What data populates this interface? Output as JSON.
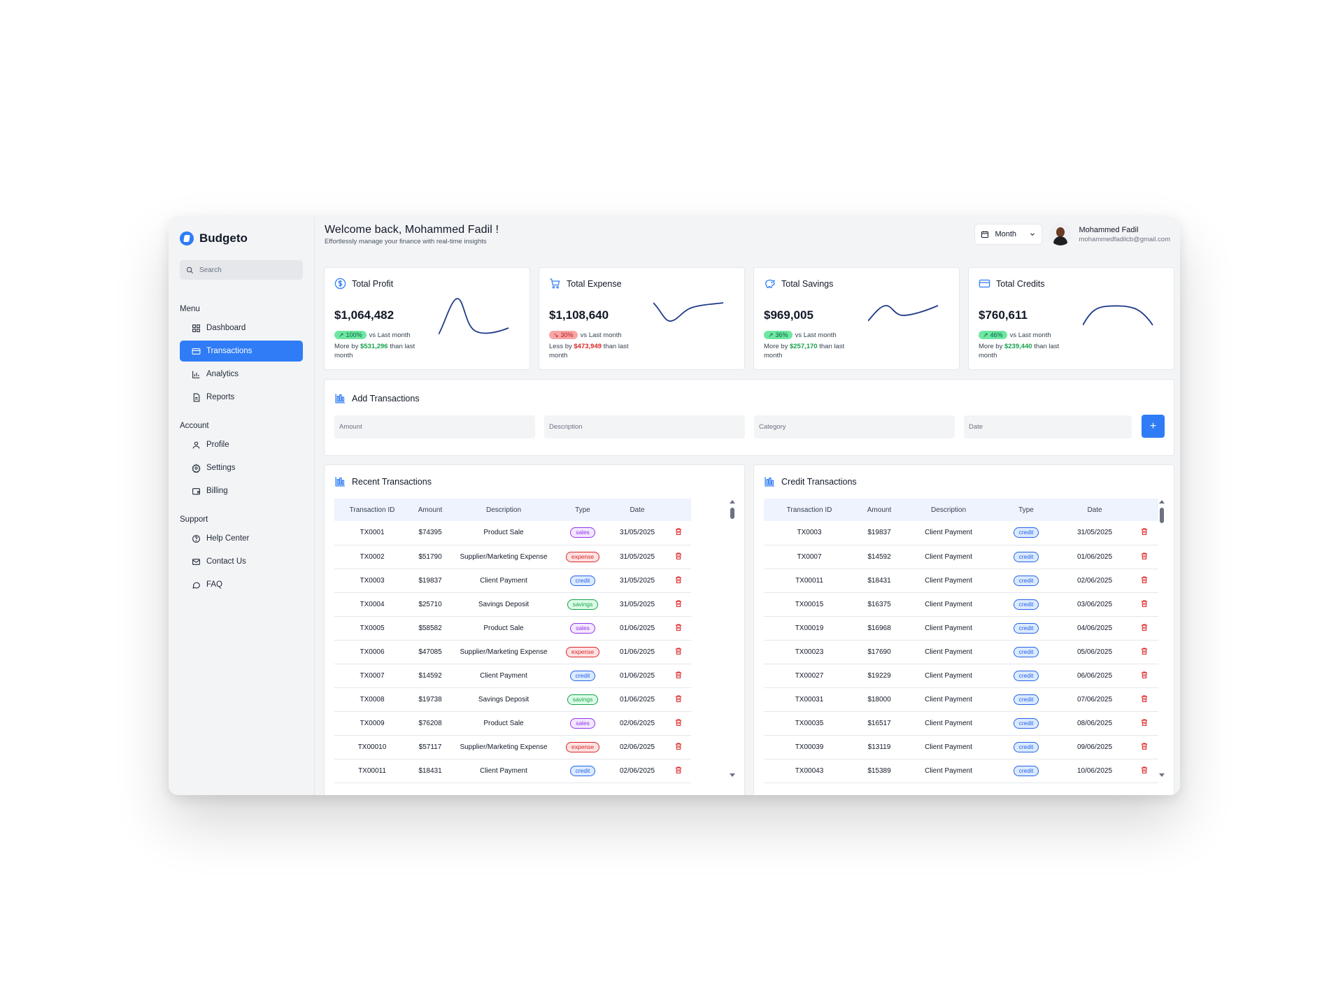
{
  "app": {
    "name": "Budgeto"
  },
  "sidebar": {
    "search_placeholder": "Search",
    "sections": {
      "menu": {
        "title": "Menu",
        "items": [
          {
            "label": "Dashboard"
          },
          {
            "label": "Transactions"
          },
          {
            "label": "Analytics"
          },
          {
            "label": "Reports"
          }
        ]
      },
      "account": {
        "title": "Account",
        "items": [
          {
            "label": "Profile"
          },
          {
            "label": "Settings"
          },
          {
            "label": "Billing"
          }
        ]
      },
      "support": {
        "title": "Support",
        "items": [
          {
            "label": "Help Center"
          },
          {
            "label": "Contact Us"
          },
          {
            "label": "FAQ"
          }
        ]
      }
    }
  },
  "header": {
    "title": "Welcome back, Mohammed Fadil !",
    "subtitle": "Effortlessly manage your finance with real-time insights",
    "period": "Month",
    "user": {
      "name": "Mohammed Fadil",
      "email": "mohammedfadilcb@gmail.com"
    }
  },
  "stats": [
    {
      "title": "Total Profit",
      "value": "$1,064,482",
      "change": "100%",
      "direction": "up",
      "vs": "vs Last month",
      "note_prefix": "More by",
      "amount": "$531,296",
      "note_suffix": "than last month",
      "icon": "dollar-icon"
    },
    {
      "title": "Total Expense",
      "value": "$1,108,640",
      "change": "30%",
      "direction": "down",
      "vs": "vs Last month",
      "note_prefix": "Less by",
      "amount": "$473,949",
      "note_suffix": "than last month",
      "icon": "cart-icon"
    },
    {
      "title": "Total Savings",
      "value": "$969,005",
      "change": "36%",
      "direction": "up",
      "vs": "vs Last month",
      "note_prefix": "More by",
      "amount": "$257,170",
      "note_suffix": "than last month",
      "icon": "piggy-bank-icon"
    },
    {
      "title": "Total Credits",
      "value": "$760,611",
      "change": "46%",
      "direction": "up",
      "vs": "vs Last month",
      "note_prefix": "More by",
      "amount": "$239,440",
      "note_suffix": "than last month",
      "icon": "credit-card-icon"
    }
  ],
  "add_transaction": {
    "title": "Add Transactions",
    "fields": {
      "amount": "Amount",
      "description": "Description",
      "category": "Category",
      "date": "Date"
    },
    "button": "+"
  },
  "recent": {
    "title": "Recent Transactions",
    "columns": [
      "Transaction ID",
      "Amount",
      "Description",
      "Type",
      "Date"
    ],
    "rows": [
      [
        "TX0001",
        "$74395",
        "Product Sale",
        "sales",
        "31/05/2025"
      ],
      [
        "TX0002",
        "$51790",
        "Supplier/Marketing Expense",
        "expense",
        "31/05/2025"
      ],
      [
        "TX0003",
        "$19837",
        "Client Payment",
        "credit",
        "31/05/2025"
      ],
      [
        "TX0004",
        "$25710",
        "Savings Deposit",
        "savings",
        "31/05/2025"
      ],
      [
        "TX0005",
        "$58582",
        "Product Sale",
        "sales",
        "01/06/2025"
      ],
      [
        "TX0006",
        "$47085",
        "Supplier/Marketing Expense",
        "expense",
        "01/06/2025"
      ],
      [
        "TX0007",
        "$14592",
        "Client Payment",
        "credit",
        "01/06/2025"
      ],
      [
        "TX0008",
        "$19738",
        "Savings Deposit",
        "savings",
        "01/06/2025"
      ],
      [
        "TX0009",
        "$76208",
        "Product Sale",
        "sales",
        "02/06/2025"
      ],
      [
        "TX00010",
        "$57117",
        "Supplier/Marketing Expense",
        "expense",
        "02/06/2025"
      ],
      [
        "TX00011",
        "$18431",
        "Client Payment",
        "credit",
        "02/06/2025"
      ]
    ]
  },
  "credit": {
    "title": "Credit Transactions",
    "columns": [
      "Transaction ID",
      "Amount",
      "Description",
      "Type",
      "Date"
    ],
    "rows": [
      [
        "TX0003",
        "$19837",
        "Client Payment",
        "credit",
        "31/05/2025"
      ],
      [
        "TX0007",
        "$14592",
        "Client Payment",
        "credit",
        "01/06/2025"
      ],
      [
        "TX00011",
        "$18431",
        "Client Payment",
        "credit",
        "02/06/2025"
      ],
      [
        "TX00015",
        "$16375",
        "Client Payment",
        "credit",
        "03/06/2025"
      ],
      [
        "TX00019",
        "$16968",
        "Client Payment",
        "credit",
        "04/06/2025"
      ],
      [
        "TX00023",
        "$17690",
        "Client Payment",
        "credit",
        "05/06/2025"
      ],
      [
        "TX00027",
        "$19229",
        "Client Payment",
        "credit",
        "06/06/2025"
      ],
      [
        "TX00031",
        "$18000",
        "Client Payment",
        "credit",
        "07/06/2025"
      ],
      [
        "TX00035",
        "$16517",
        "Client Payment",
        "credit",
        "08/06/2025"
      ],
      [
        "TX00039",
        "$13119",
        "Client Payment",
        "credit",
        "09/06/2025"
      ],
      [
        "TX00043",
        "$15389",
        "Client Payment",
        "credit",
        "10/06/2025"
      ]
    ]
  },
  "colors": {
    "accent": "#2f7cf6",
    "positive": "#16a34a",
    "negative": "#dc2626",
    "sparkline": "#1e3a8a"
  }
}
